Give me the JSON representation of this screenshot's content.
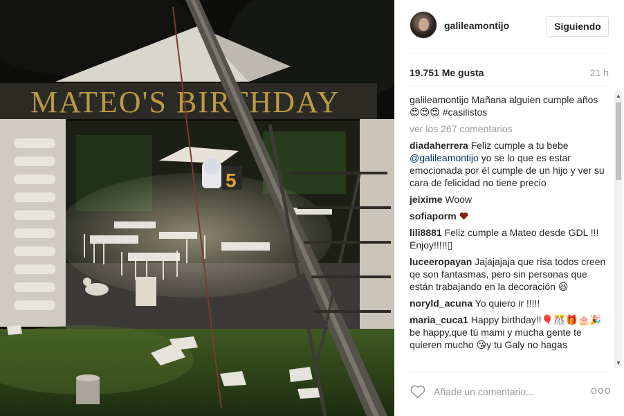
{
  "post": {
    "username": "galileamontijo",
    "follow_label": "Siguiendo",
    "likes": "19.751 Me gusta",
    "time": "21 h",
    "caption": {
      "user": "galileamontijo",
      "text": "Mañana alguien cumple años 😍😍😍 ",
      "hashtag": "#casilistos"
    },
    "view_comments": "ver los 267 comentarios",
    "comments": [
      {
        "user": "diadaherrera",
        "pre": "Feliz cumple a tu bebe ",
        "mention": "@galileamontijo",
        "post": " yo se lo que es estar emocionada por él cumple de un hijo y ver su cara de felicidad no tiene precio"
      },
      {
        "user": "jeixime",
        "pre": "Woow",
        "mention": "",
        "post": ""
      },
      {
        "user": "sofiaporm",
        "pre": "",
        "mention": "",
        "post": "",
        "heart": true
      },
      {
        "user": "lili8881",
        "pre": "Feliz cumple a Mateo desde GDL !!! Enjoy!!!!!▯",
        "mention": "",
        "post": ""
      },
      {
        "user": "luceeropayan",
        "pre": "Jajajajaja que risa todos creen qe son fantasmas, pero sin personas que están trabajando en la decoración 😆",
        "mention": "",
        "post": ""
      },
      {
        "user": "noryld_acuna",
        "pre": "Yo quiero ir !!!!!",
        "mention": "",
        "post": ""
      },
      {
        "user": "maria_cuca1",
        "pre": "Happy birthday!!🎈🎊🎁🎂🎉 be happy,que tú mami y mucha gente te quieren mucho 😘y tu Galy no hagas",
        "mention": "",
        "post": ""
      }
    ],
    "comment_placeholder": "Añade un comentario...",
    "options_label": "ooo"
  },
  "photo": {
    "sign_text": "MATEO'S BIRTHDAY",
    "number": "5"
  },
  "colors": {
    "link": "#003569",
    "muted": "#999999",
    "heart": "#8b1a1a",
    "sign_gold": "#b99a45"
  },
  "icons": {
    "like": "heart-outline-icon",
    "options": "ellipsis-icon",
    "scroll_up": "chevron-up-icon",
    "scroll_down": "chevron-down-icon"
  }
}
